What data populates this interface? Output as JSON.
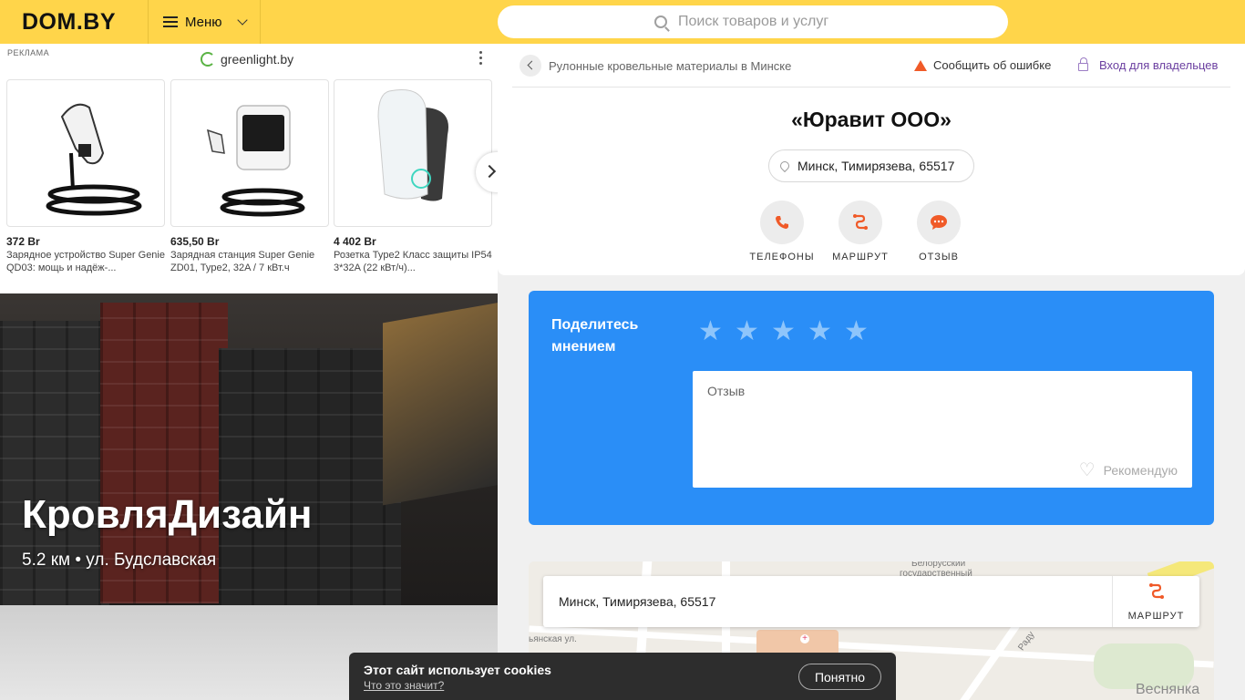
{
  "header": {
    "logo": "DOM.BY",
    "menu_label": "Меню",
    "search_placeholder": "Поиск товаров и услуг"
  },
  "ad": {
    "label": "РЕКЛАМА",
    "brand": "greenlight.by",
    "items": [
      {
        "price": "372 Br",
        "title": "Зарядное устройство Super Genie QD03: мощь и надёж-..."
      },
      {
        "price": "635,50 Br",
        "title": "Зарядная станция Super Genie ZD01, Type2, 32A / 7 кВт.ч"
      },
      {
        "price": "4 402 Br",
        "title": "Розетка Type2 Класс защиты IP54 3*32A (22 кВт/ч)..."
      }
    ]
  },
  "promo": {
    "title": "КровляДизайн",
    "subtitle": "5.2 км • ул. Будславская"
  },
  "company": {
    "breadcrumb": "Рулонные кровельные материалы в Минске",
    "report_label": "Сообщить об ошибке",
    "owner_label": "Вход для владельцев",
    "name": "«Юравит ООО»",
    "address": "Минск, Тимирязева, 65517",
    "actions": [
      {
        "label": "ТЕЛЕФОНЫ",
        "icon": "phone-icon"
      },
      {
        "label": "МАРШРУТ",
        "icon": "route-icon"
      },
      {
        "label": "ОТЗЫВ",
        "icon": "chat-icon"
      }
    ]
  },
  "review": {
    "title": "Поделитесь мнением",
    "placeholder": "Отзыв",
    "recommend_label": "Рекомендую",
    "stars": 5
  },
  "map": {
    "address": "Минск, Тимирязева, 65517",
    "route_label": "МАРШРУТ",
    "labels": [
      "Белорусский",
      "государственный",
      "Веснянка",
      "ьянская ул.",
      "Раду"
    ]
  },
  "cookies": {
    "text": "Этот сайт использует cookies",
    "link": "Что это значит?",
    "button": "Понятно"
  },
  "colors": {
    "header_bg": "#ffd54a",
    "review_bg": "#2a8ef7",
    "accent_orange": "#f05a28",
    "owner_link": "#6b3fa0"
  }
}
